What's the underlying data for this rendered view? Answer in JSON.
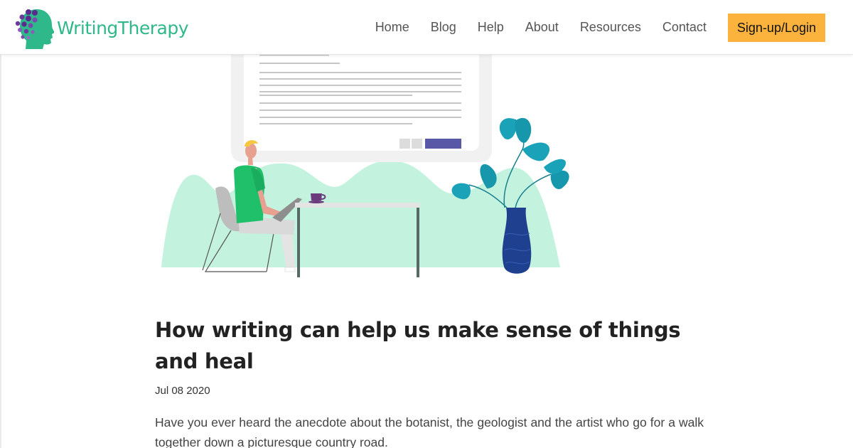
{
  "header": {
    "logo_text": "WritingTherapy",
    "nav": [
      "Home",
      "Blog",
      "Help",
      "About",
      "Resources",
      "Contact"
    ],
    "signup_label": "Sign-up/Login"
  },
  "article": {
    "title": "How writing can help us make sense of things and heal",
    "date": "Jul 08 2020",
    "excerpt": "Have you ever heard the anecdote about the botanist, the geologist and the artist who go for a walk together down a picturesque country road."
  },
  "colors": {
    "brand_green": "#2fb889",
    "brand_purple": "#5a2a8c",
    "signup_bg": "#fbb33d",
    "hill_mint": "#c3f3df",
    "shirt_green": "#20c06a",
    "vase_blue": "#1f3f8f",
    "leaf_teal": "#1aa3b8",
    "button_indigo": "#5858a6"
  },
  "icons": [
    "head-logo-icon"
  ]
}
